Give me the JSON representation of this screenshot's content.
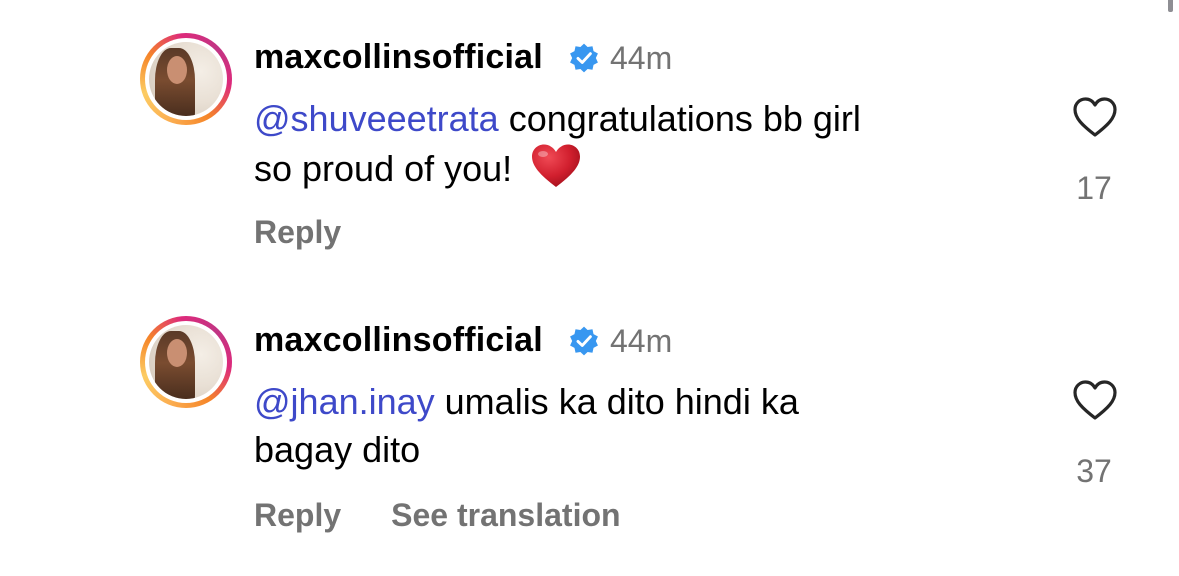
{
  "comments": [
    {
      "username": "maxcollinsofficial",
      "time_ago": "44m",
      "mention": "@shuveeetrata",
      "text_line1": " congratulations bb girl",
      "text_line2": "so proud of you!",
      "emoji": "red-heart-emoji",
      "reply_label": "Reply",
      "like_count": "17"
    },
    {
      "username": "maxcollinsofficial",
      "time_ago": "44m",
      "mention": "@jhan.inay",
      "text_line1": " umalis ka dito hindi ka",
      "text_line2": "bagay dito",
      "reply_label": "Reply",
      "see_translation_label": "See translation",
      "like_count": "37"
    }
  ],
  "icons": {
    "verified": "verified-badge-icon",
    "like": "heart-outline-icon"
  },
  "colors": {
    "mention": "#3e49c9",
    "secondary_text": "#737373",
    "verified_badge": "#3897f0",
    "emoji_heart": "#d11f2e"
  }
}
